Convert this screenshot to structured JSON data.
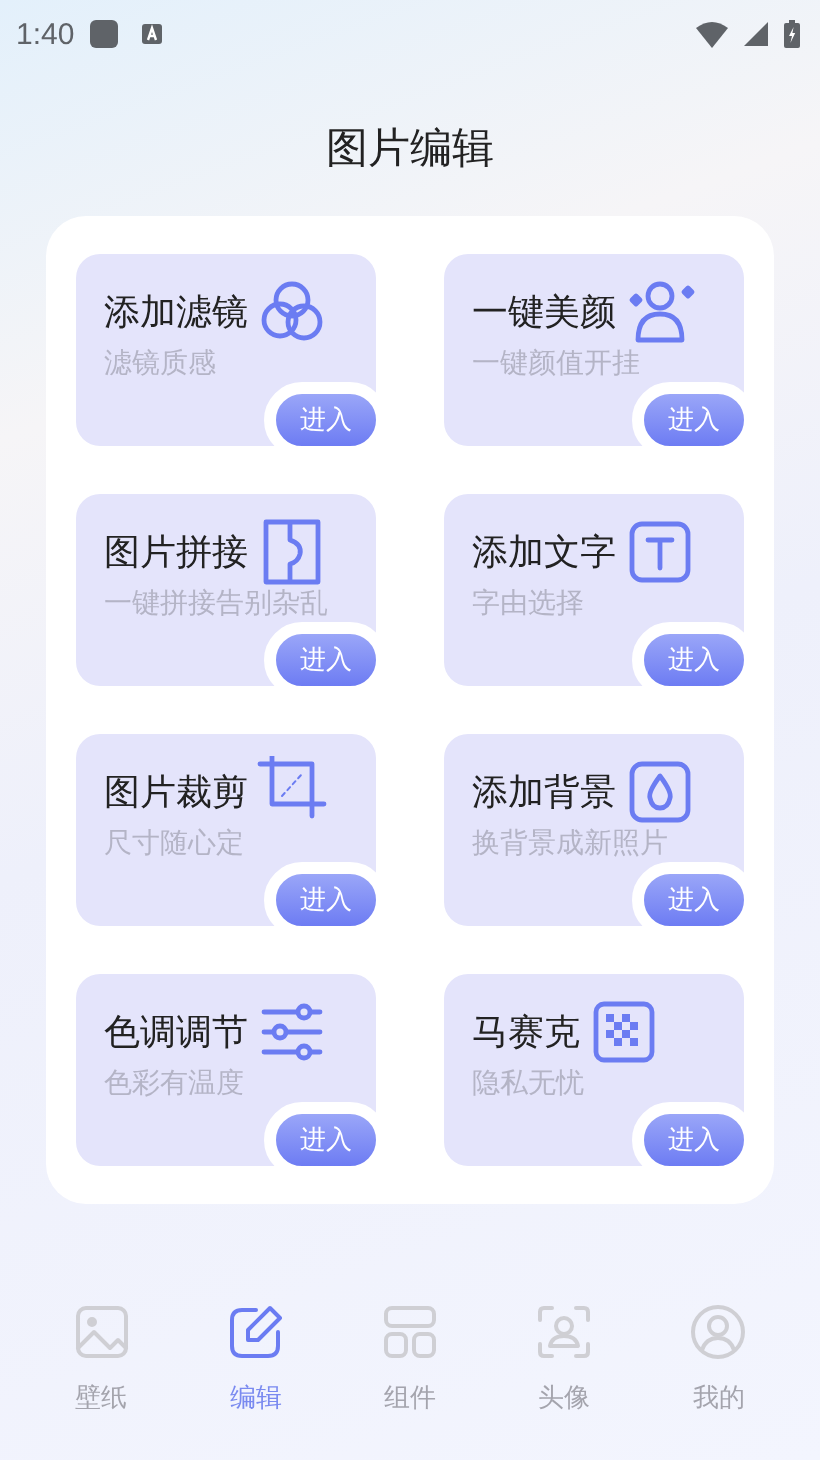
{
  "status_bar": {
    "time": "1:40"
  },
  "title": "图片编辑",
  "tools": [
    {
      "kind": "filter",
      "title": "添加滤镜",
      "subtitle": "滤镜质感",
      "button": "进入"
    },
    {
      "kind": "beauty",
      "title": "一键美颜",
      "subtitle": "一键颜值开挂",
      "button": "进入"
    },
    {
      "kind": "collage",
      "title": "图片拼接",
      "subtitle": "一键拼接告别杂乱",
      "button": "进入"
    },
    {
      "kind": "text",
      "title": "添加文字",
      "subtitle": "字由选择",
      "button": "进入"
    },
    {
      "kind": "crop",
      "title": "图片裁剪",
      "subtitle": "尺寸随心定",
      "button": "进入"
    },
    {
      "kind": "background",
      "title": "添加背景",
      "subtitle": "换背景成新照片",
      "button": "进入"
    },
    {
      "kind": "tune",
      "title": "色调调节",
      "subtitle": "色彩有温度",
      "button": "进入"
    },
    {
      "kind": "mosaic",
      "title": "马赛克",
      "subtitle": "隐私无忧",
      "button": "进入"
    }
  ],
  "tabs": [
    {
      "kind": "wallpaper",
      "label": "壁纸",
      "selected": false
    },
    {
      "kind": "edit",
      "label": "编辑",
      "selected": true
    },
    {
      "kind": "widget",
      "label": "组件",
      "selected": false
    },
    {
      "kind": "avatar",
      "label": "头像",
      "selected": false
    },
    {
      "kind": "profile",
      "label": "我的",
      "selected": false
    }
  ]
}
